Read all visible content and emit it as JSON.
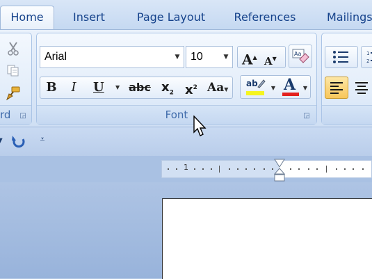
{
  "tabs": [
    {
      "label": "Home",
      "active": true
    },
    {
      "label": "Insert"
    },
    {
      "label": "Page Layout"
    },
    {
      "label": "References"
    },
    {
      "label": "Mailings"
    }
  ],
  "clipboard": {
    "group_label_partial": "rd",
    "icons": [
      "cut-icon",
      "copy-icon",
      "format-painter-icon"
    ]
  },
  "font_group": {
    "label": "Font",
    "font_name": "Arial",
    "font_size": "10",
    "grow_font": "A",
    "shrink_font": "A",
    "bold": "B",
    "italic": "I",
    "underline": "U",
    "strikethrough": "abc",
    "subscript": "x",
    "subscript_sub": "2",
    "superscript": "x",
    "superscript_sup": "2",
    "change_case": "Aa",
    "highlight_text": "ab",
    "font_color": "A",
    "colors": {
      "highlight": "#f5f51f",
      "font_color": "#e3221f"
    }
  },
  "ruler": {
    "number": "1"
  }
}
